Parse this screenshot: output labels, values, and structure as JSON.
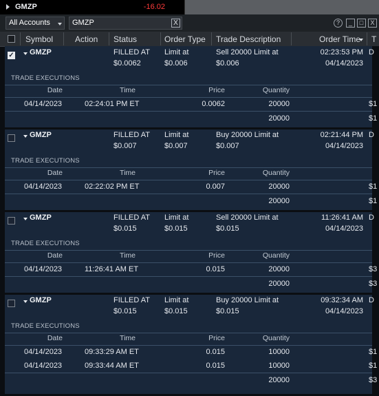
{
  "ticker": {
    "symbol": "GMZP",
    "change": "-16.02"
  },
  "filter": {
    "account": "All Accounts",
    "search": "GMZP",
    "clear": "X"
  },
  "window_buttons": {
    "help": "?",
    "minimize": "_",
    "restore": "□",
    "close": "X"
  },
  "columns": [
    "Symbol",
    "Action",
    "Status",
    "Order Type",
    "Trade Description",
    "Order Time",
    "T"
  ],
  "exec_section": "TRADE EXECUTIONS",
  "exec_columns": [
    "Date",
    "Time",
    "Price",
    "Quantity"
  ],
  "orders": [
    {
      "checked": true,
      "symbol": "GMZP",
      "status": [
        "FILLED AT",
        "$0.0062"
      ],
      "order_type": [
        "Limit at",
        "$0.006"
      ],
      "description": [
        "Sell 20000 Limit at",
        "$0.006"
      ],
      "time": [
        "02:23:53 PM",
        "04/14/2023"
      ],
      "cut": "D",
      "executions": [
        {
          "date": "04/14/2023",
          "time": "02:24:01 PM ET",
          "price": "0.0062",
          "quantity": "20000",
          "cut": "$1"
        }
      ],
      "total": "20000",
      "total_cut": "$1"
    },
    {
      "checked": false,
      "symbol": "GMZP",
      "status": [
        "FILLED AT",
        "$0.007"
      ],
      "order_type": [
        "Limit at",
        "$0.007"
      ],
      "description": [
        "Buy 20000 Limit at",
        "$0.007"
      ],
      "time": [
        "02:21:44 PM",
        "04/14/2023"
      ],
      "cut": "D",
      "executions": [
        {
          "date": "04/14/2023",
          "time": "02:22:02 PM ET",
          "price": "0.007",
          "quantity": "20000",
          "cut": "$1"
        }
      ],
      "total": "20000",
      "total_cut": "$1"
    },
    {
      "checked": false,
      "symbol": "GMZP",
      "status": [
        "FILLED AT",
        "$0.015"
      ],
      "order_type": [
        "Limit at",
        "$0.015"
      ],
      "description": [
        "Sell 20000 Limit at",
        "$0.015"
      ],
      "time": [
        "11:26:41 AM",
        "04/14/2023"
      ],
      "cut": "D",
      "executions": [
        {
          "date": "04/14/2023",
          "time": "11:26:41 AM ET",
          "price": "0.015",
          "quantity": "20000",
          "cut": "$3"
        }
      ],
      "total": "20000",
      "total_cut": "$3"
    },
    {
      "checked": false,
      "symbol": "GMZP",
      "status": [
        "FILLED AT",
        "$0.015"
      ],
      "order_type": [
        "Limit at",
        "$0.015"
      ],
      "description": [
        "Buy 20000 Limit at",
        "$0.015"
      ],
      "time": [
        "09:32:34 AM",
        "04/14/2023"
      ],
      "cut": "D",
      "executions": [
        {
          "date": "04/14/2023",
          "time": "09:33:29 AM ET",
          "price": "0.015",
          "quantity": "10000",
          "cut": "$1"
        },
        {
          "date": "04/14/2023",
          "time": "09:33:44 AM ET",
          "price": "0.015",
          "quantity": "10000",
          "cut": "$1"
        }
      ],
      "total": "20000",
      "total_cut": "$3"
    }
  ]
}
